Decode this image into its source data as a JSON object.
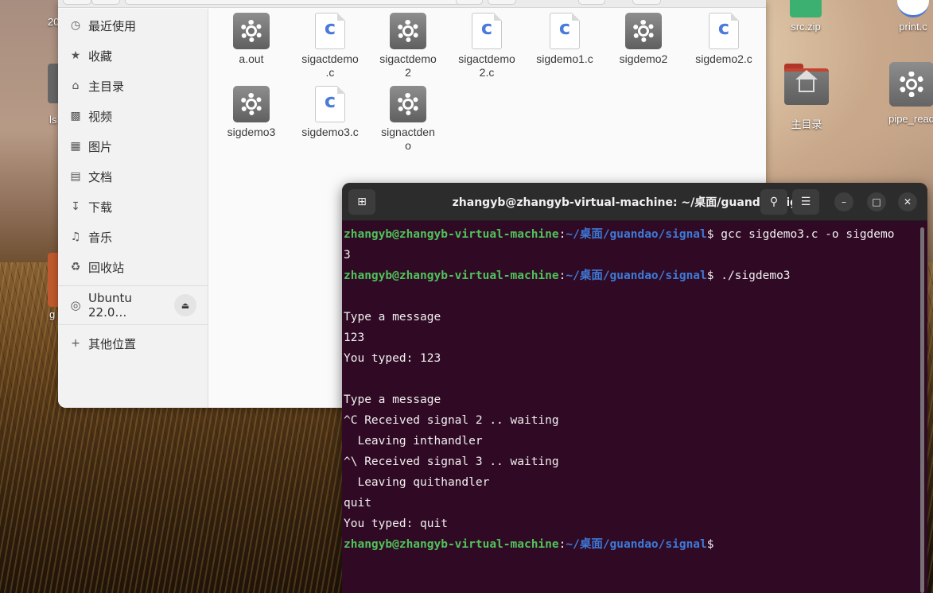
{
  "desktop": {
    "icons": [
      {
        "label": "src.zip"
      },
      {
        "label": "print.c"
      },
      {
        "label": "主目录"
      },
      {
        "label": "pipe_read"
      }
    ],
    "partial_left": [
      "20",
      "ls",
      "g"
    ]
  },
  "file_manager": {
    "sidebar": {
      "items": [
        {
          "label": "最近使用",
          "icon": "clock-icon"
        },
        {
          "label": "收藏",
          "icon": "star-icon"
        },
        {
          "label": "主目录",
          "icon": "home-icon"
        },
        {
          "label": "视频",
          "icon": "film-icon"
        },
        {
          "label": "图片",
          "icon": "image-icon"
        },
        {
          "label": "文档",
          "icon": "document-icon"
        },
        {
          "label": "下载",
          "icon": "download-icon"
        },
        {
          "label": "音乐",
          "icon": "music-icon"
        },
        {
          "label": "回收站",
          "icon": "trash-icon"
        }
      ],
      "drive": {
        "label": "Ubuntu 22.0…",
        "icon": "disc-icon"
      },
      "other": {
        "label": "其他位置",
        "icon": "plus-icon"
      }
    },
    "files": [
      {
        "name": "a.out",
        "type": "exec"
      },
      {
        "name": "sigactdemo.c",
        "type": "c"
      },
      {
        "name": "sigactdemo2",
        "type": "exec"
      },
      {
        "name": "sigactdemo2.c",
        "type": "c"
      },
      {
        "name": "sigdemo1.c",
        "type": "c"
      },
      {
        "name": "sigdemo2",
        "type": "exec"
      },
      {
        "name": "sigdemo2.c",
        "type": "c"
      },
      {
        "name": "sigdemo3",
        "type": "exec"
      },
      {
        "name": "sigdemo3.c",
        "type": "c"
      },
      {
        "name": "signactdemo",
        "type": "exec"
      }
    ],
    "file_display": [
      [
        "a.out"
      ],
      [
        "sigactdemo",
        ".c"
      ],
      [
        "sigactdemo",
        "2"
      ],
      [
        "sigactdemo",
        "2.c"
      ],
      [
        "sigdemo1.c"
      ],
      [
        "sigdemo2"
      ],
      [
        "sigdemo2.c"
      ],
      [
        "sigdemo3"
      ],
      [
        "sigdemo3.c"
      ],
      [
        "signactden",
        "o"
      ]
    ]
  },
  "terminal": {
    "title": "zhangyb@zhangyb-virtual-machine: ~/桌面/guandao/signal",
    "prompt_user": "zhangyb@zhangyb-virtual-machine",
    "prompt_colon": ":",
    "prompt_path": "~/桌面/guandao/signal",
    "lines": [
      {
        "kind": "prompt",
        "cmd": "$ gcc sigdemo3.c -o sigdemo"
      },
      {
        "kind": "text",
        "text": "3"
      },
      {
        "kind": "prompt",
        "cmd": "$ ./sigdemo3"
      },
      {
        "kind": "text",
        "text": ""
      },
      {
        "kind": "text",
        "text": "Type a message"
      },
      {
        "kind": "text",
        "text": "123"
      },
      {
        "kind": "text",
        "text": "You typed: 123"
      },
      {
        "kind": "text",
        "text": ""
      },
      {
        "kind": "text",
        "text": "Type a message"
      },
      {
        "kind": "text",
        "text": "^C Received signal 2 .. waiting"
      },
      {
        "kind": "text",
        "text": "  Leaving inthandler"
      },
      {
        "kind": "text",
        "text": "^\\ Received signal 3 .. waiting"
      },
      {
        "kind": "text",
        "text": "  Leaving quithandler"
      },
      {
        "kind": "text",
        "text": "quit"
      },
      {
        "kind": "text",
        "text": "You typed: quit"
      },
      {
        "kind": "prompt",
        "cmd": "$"
      }
    ],
    "buttons": {
      "new_tab": "new-tab-icon",
      "search": "search-icon",
      "menu": "hamburger-menu-icon",
      "minimize": "minimize-icon",
      "maximize": "maximize-icon",
      "close": "close-icon"
    },
    "colors": {
      "background": "#300a24",
      "user": "#4fc25b",
      "path": "#3d7ad8",
      "text": "#f0f0f0"
    }
  }
}
